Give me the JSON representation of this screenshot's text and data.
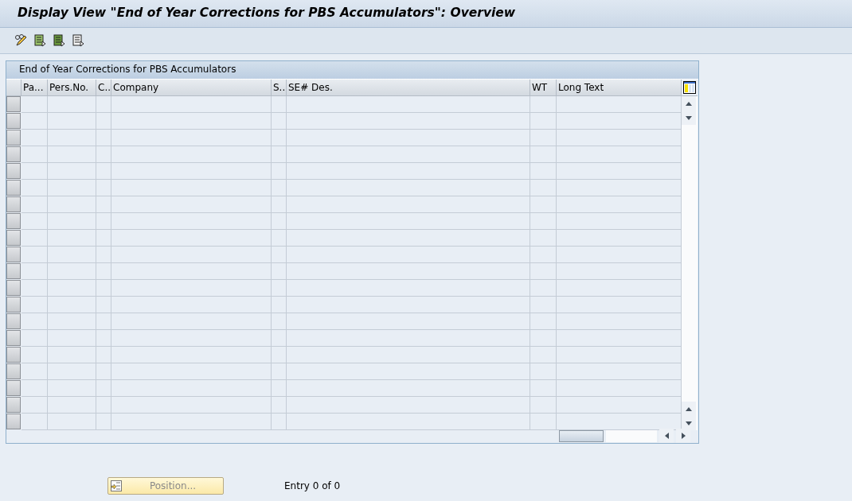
{
  "window": {
    "title": "Display View \"End of Year Corrections for PBS Accumulators\": Overview"
  },
  "table": {
    "title": "End of Year Corrections for PBS Accumulators",
    "columns": [
      "Pa...",
      "Pers.No.",
      "C..",
      "Company",
      "S..",
      "SE# Des.",
      "WT",
      "Long Text"
    ]
  },
  "footer": {
    "position_button": {
      "label": "Position...",
      "disabled": true
    },
    "entry_count": "Entry 0 of 0"
  }
}
